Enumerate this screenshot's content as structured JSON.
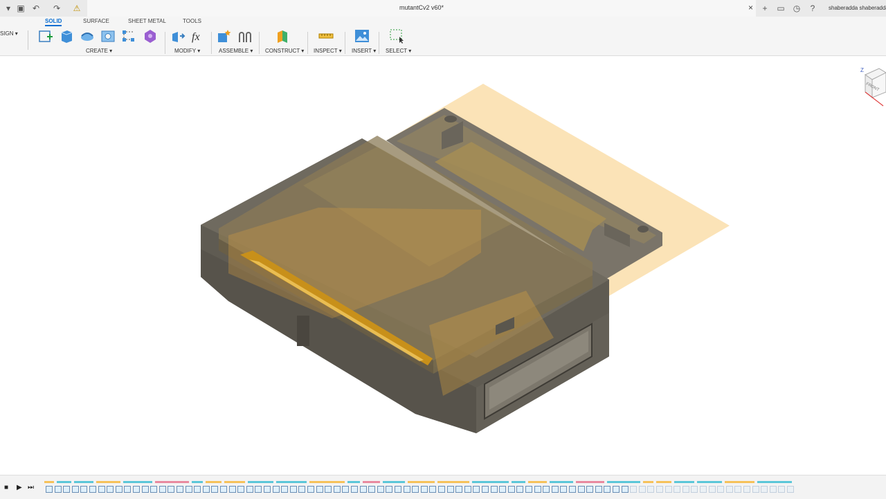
{
  "window": {
    "title": "mutantCv2 v60*",
    "user": "shaberadda shaberadda"
  },
  "workspace": {
    "label": "SIGN ▾"
  },
  "tabs": [
    {
      "label": "SOLID",
      "active": true
    },
    {
      "label": "SURFACE",
      "active": false
    },
    {
      "label": "SHEET METAL",
      "active": false
    },
    {
      "label": "TOOLS",
      "active": false
    }
  ],
  "groups": [
    {
      "label": "CREATE ▾"
    },
    {
      "label": "MODIFY ▾"
    },
    {
      "label": "ASSEMBLE ▾"
    },
    {
      "label": "CONSTRUCT ▾"
    },
    {
      "label": "INSPECT ▾"
    },
    {
      "label": "INSERT ▾"
    },
    {
      "label": "SELECT ▾"
    }
  ],
  "viewcube": {
    "axis": "Z",
    "face": "FRONT"
  },
  "colors": {
    "accent": "#0a6ed1",
    "body": "#5d5a51",
    "plane": "#f6c77a"
  }
}
